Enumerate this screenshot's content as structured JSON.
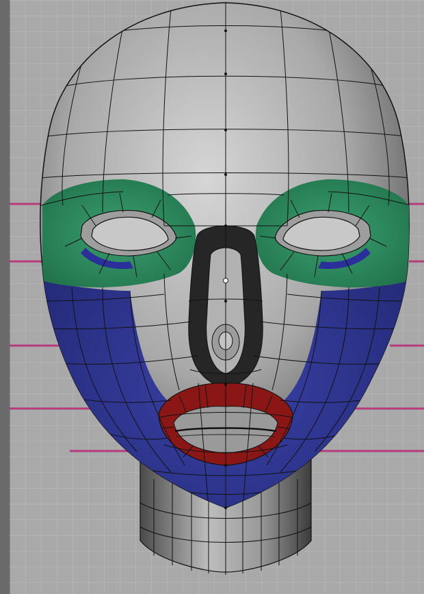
{
  "viewport": {
    "kind": "3d-modeling-viewport",
    "background_color": "#a9a9a9",
    "grid_line_color": "#bdbdbd",
    "guide_line_color": "#b83a7c"
  },
  "model": {
    "subject": "head",
    "shading": "grey-wireframe",
    "base_color": "#9a9a9a",
    "wire_color": "#111111",
    "regions": [
      {
        "name": "eye-sockets",
        "color": "#2e8a5e"
      },
      {
        "name": "cheeks-jaw",
        "color": "#272e86"
      },
      {
        "name": "nose-loop",
        "color": "#2a2a2a"
      },
      {
        "name": "mouth-ring",
        "color": "#8a1616"
      }
    ],
    "pivot_marker": "origin-dot"
  }
}
